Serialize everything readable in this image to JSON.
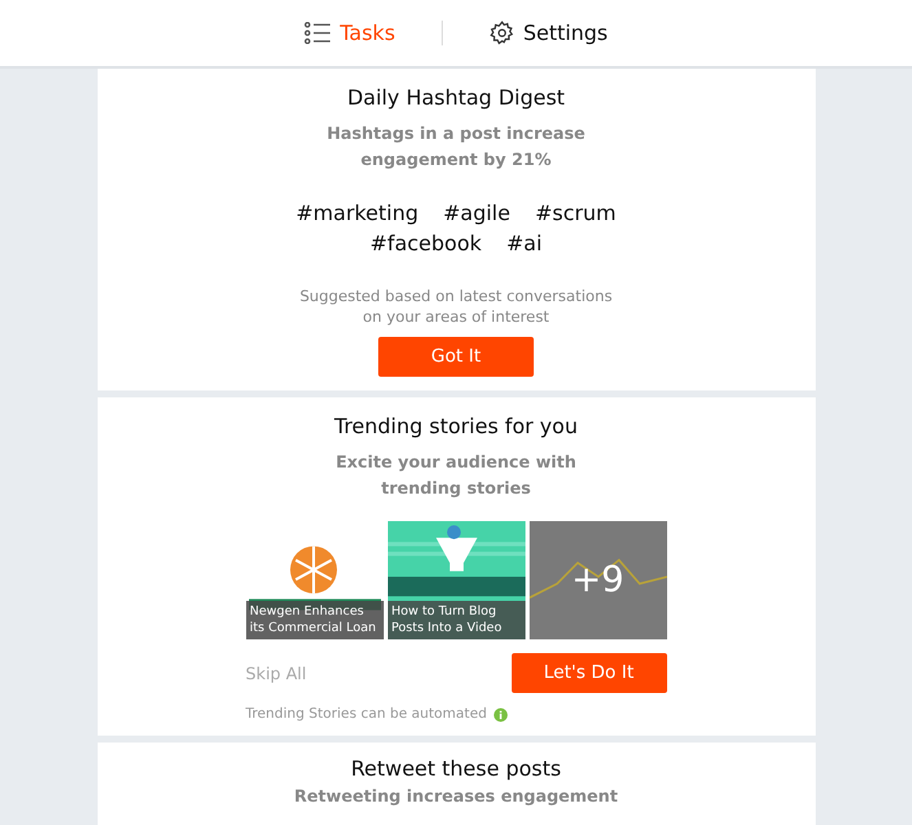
{
  "tabs": [
    {
      "label": "Tasks",
      "selected": true
    },
    {
      "label": "Settings",
      "selected": false
    }
  ],
  "hashtag_card": {
    "title": "Daily Hashtag Digest",
    "subtitle": "Hashtags in a post increase engagement by 21%",
    "hashtags": [
      "#marketing",
      "#agile",
      "#scrum",
      "#facebook",
      "#ai"
    ],
    "note": "Suggested based on latest conversations on your areas of interest",
    "button": "Got It"
  },
  "trending_card": {
    "title": "Trending stories for you",
    "subtitle": "Excite your audience with trending stories",
    "stories": [
      {
        "kind": "picture",
        "caption": "Newgen Enhances its Commercial Loan"
      },
      {
        "kind": "picture",
        "caption": "How to Turn Blog Posts Into a Video"
      },
      {
        "kind": "more",
        "count": "+9"
      }
    ],
    "skip": "Skip All",
    "button": "Let's Do It",
    "footnote": "Trending Stories can be automated"
  },
  "retweet_card": {
    "title": "Retweet these posts",
    "subtitle": "Retweeting increases engagement"
  }
}
